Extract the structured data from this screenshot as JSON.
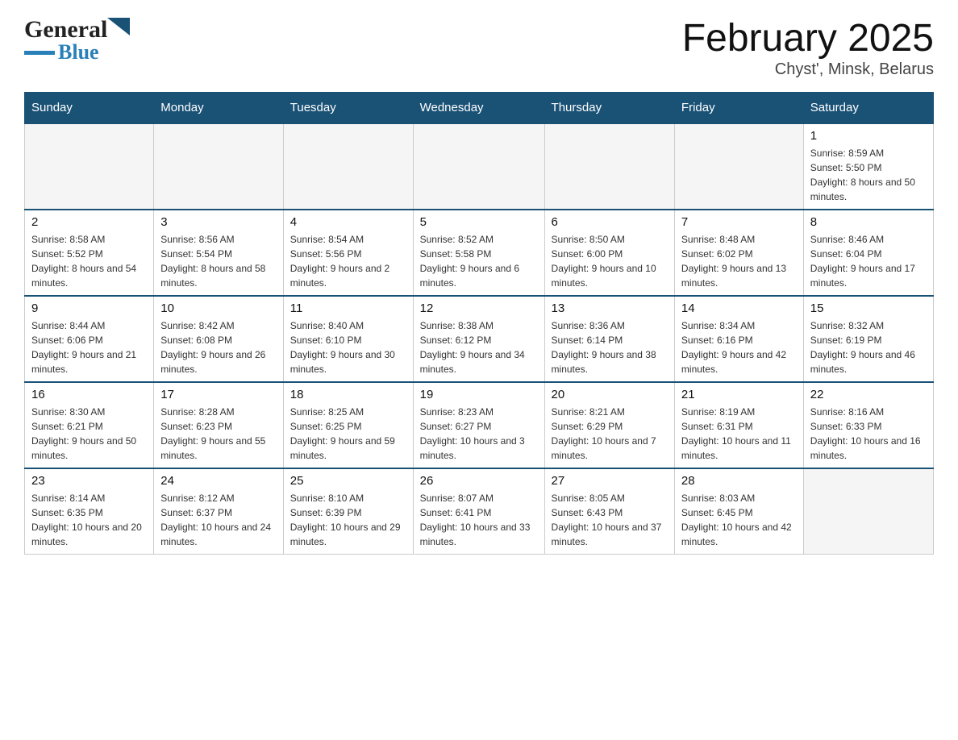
{
  "header": {
    "logo_general": "General",
    "logo_blue": "Blue",
    "month_title": "February 2025",
    "location": "Chyst', Minsk, Belarus"
  },
  "weekdays": [
    "Sunday",
    "Monday",
    "Tuesday",
    "Wednesday",
    "Thursday",
    "Friday",
    "Saturday"
  ],
  "weeks": [
    [
      {
        "day": "",
        "sunrise": "",
        "sunset": "",
        "daylight": "",
        "empty": true
      },
      {
        "day": "",
        "sunrise": "",
        "sunset": "",
        "daylight": "",
        "empty": true
      },
      {
        "day": "",
        "sunrise": "",
        "sunset": "",
        "daylight": "",
        "empty": true
      },
      {
        "day": "",
        "sunrise": "",
        "sunset": "",
        "daylight": "",
        "empty": true
      },
      {
        "day": "",
        "sunrise": "",
        "sunset": "",
        "daylight": "",
        "empty": true
      },
      {
        "day": "",
        "sunrise": "",
        "sunset": "",
        "daylight": "",
        "empty": true
      },
      {
        "day": "1",
        "sunrise": "Sunrise: 8:59 AM",
        "sunset": "Sunset: 5:50 PM",
        "daylight": "Daylight: 8 hours and 50 minutes.",
        "empty": false
      }
    ],
    [
      {
        "day": "2",
        "sunrise": "Sunrise: 8:58 AM",
        "sunset": "Sunset: 5:52 PM",
        "daylight": "Daylight: 8 hours and 54 minutes.",
        "empty": false
      },
      {
        "day": "3",
        "sunrise": "Sunrise: 8:56 AM",
        "sunset": "Sunset: 5:54 PM",
        "daylight": "Daylight: 8 hours and 58 minutes.",
        "empty": false
      },
      {
        "day": "4",
        "sunrise": "Sunrise: 8:54 AM",
        "sunset": "Sunset: 5:56 PM",
        "daylight": "Daylight: 9 hours and 2 minutes.",
        "empty": false
      },
      {
        "day": "5",
        "sunrise": "Sunrise: 8:52 AM",
        "sunset": "Sunset: 5:58 PM",
        "daylight": "Daylight: 9 hours and 6 minutes.",
        "empty": false
      },
      {
        "day": "6",
        "sunrise": "Sunrise: 8:50 AM",
        "sunset": "Sunset: 6:00 PM",
        "daylight": "Daylight: 9 hours and 10 minutes.",
        "empty": false
      },
      {
        "day": "7",
        "sunrise": "Sunrise: 8:48 AM",
        "sunset": "Sunset: 6:02 PM",
        "daylight": "Daylight: 9 hours and 13 minutes.",
        "empty": false
      },
      {
        "day": "8",
        "sunrise": "Sunrise: 8:46 AM",
        "sunset": "Sunset: 6:04 PM",
        "daylight": "Daylight: 9 hours and 17 minutes.",
        "empty": false
      }
    ],
    [
      {
        "day": "9",
        "sunrise": "Sunrise: 8:44 AM",
        "sunset": "Sunset: 6:06 PM",
        "daylight": "Daylight: 9 hours and 21 minutes.",
        "empty": false
      },
      {
        "day": "10",
        "sunrise": "Sunrise: 8:42 AM",
        "sunset": "Sunset: 6:08 PM",
        "daylight": "Daylight: 9 hours and 26 minutes.",
        "empty": false
      },
      {
        "day": "11",
        "sunrise": "Sunrise: 8:40 AM",
        "sunset": "Sunset: 6:10 PM",
        "daylight": "Daylight: 9 hours and 30 minutes.",
        "empty": false
      },
      {
        "day": "12",
        "sunrise": "Sunrise: 8:38 AM",
        "sunset": "Sunset: 6:12 PM",
        "daylight": "Daylight: 9 hours and 34 minutes.",
        "empty": false
      },
      {
        "day": "13",
        "sunrise": "Sunrise: 8:36 AM",
        "sunset": "Sunset: 6:14 PM",
        "daylight": "Daylight: 9 hours and 38 minutes.",
        "empty": false
      },
      {
        "day": "14",
        "sunrise": "Sunrise: 8:34 AM",
        "sunset": "Sunset: 6:16 PM",
        "daylight": "Daylight: 9 hours and 42 minutes.",
        "empty": false
      },
      {
        "day": "15",
        "sunrise": "Sunrise: 8:32 AM",
        "sunset": "Sunset: 6:19 PM",
        "daylight": "Daylight: 9 hours and 46 minutes.",
        "empty": false
      }
    ],
    [
      {
        "day": "16",
        "sunrise": "Sunrise: 8:30 AM",
        "sunset": "Sunset: 6:21 PM",
        "daylight": "Daylight: 9 hours and 50 minutes.",
        "empty": false
      },
      {
        "day": "17",
        "sunrise": "Sunrise: 8:28 AM",
        "sunset": "Sunset: 6:23 PM",
        "daylight": "Daylight: 9 hours and 55 minutes.",
        "empty": false
      },
      {
        "day": "18",
        "sunrise": "Sunrise: 8:25 AM",
        "sunset": "Sunset: 6:25 PM",
        "daylight": "Daylight: 9 hours and 59 minutes.",
        "empty": false
      },
      {
        "day": "19",
        "sunrise": "Sunrise: 8:23 AM",
        "sunset": "Sunset: 6:27 PM",
        "daylight": "Daylight: 10 hours and 3 minutes.",
        "empty": false
      },
      {
        "day": "20",
        "sunrise": "Sunrise: 8:21 AM",
        "sunset": "Sunset: 6:29 PM",
        "daylight": "Daylight: 10 hours and 7 minutes.",
        "empty": false
      },
      {
        "day": "21",
        "sunrise": "Sunrise: 8:19 AM",
        "sunset": "Sunset: 6:31 PM",
        "daylight": "Daylight: 10 hours and 11 minutes.",
        "empty": false
      },
      {
        "day": "22",
        "sunrise": "Sunrise: 8:16 AM",
        "sunset": "Sunset: 6:33 PM",
        "daylight": "Daylight: 10 hours and 16 minutes.",
        "empty": false
      }
    ],
    [
      {
        "day": "23",
        "sunrise": "Sunrise: 8:14 AM",
        "sunset": "Sunset: 6:35 PM",
        "daylight": "Daylight: 10 hours and 20 minutes.",
        "empty": false
      },
      {
        "day": "24",
        "sunrise": "Sunrise: 8:12 AM",
        "sunset": "Sunset: 6:37 PM",
        "daylight": "Daylight: 10 hours and 24 minutes.",
        "empty": false
      },
      {
        "day": "25",
        "sunrise": "Sunrise: 8:10 AM",
        "sunset": "Sunset: 6:39 PM",
        "daylight": "Daylight: 10 hours and 29 minutes.",
        "empty": false
      },
      {
        "day": "26",
        "sunrise": "Sunrise: 8:07 AM",
        "sunset": "Sunset: 6:41 PM",
        "daylight": "Daylight: 10 hours and 33 minutes.",
        "empty": false
      },
      {
        "day": "27",
        "sunrise": "Sunrise: 8:05 AM",
        "sunset": "Sunset: 6:43 PM",
        "daylight": "Daylight: 10 hours and 37 minutes.",
        "empty": false
      },
      {
        "day": "28",
        "sunrise": "Sunrise: 8:03 AM",
        "sunset": "Sunset: 6:45 PM",
        "daylight": "Daylight: 10 hours and 42 minutes.",
        "empty": false
      },
      {
        "day": "",
        "sunrise": "",
        "sunset": "",
        "daylight": "",
        "empty": true
      }
    ]
  ]
}
